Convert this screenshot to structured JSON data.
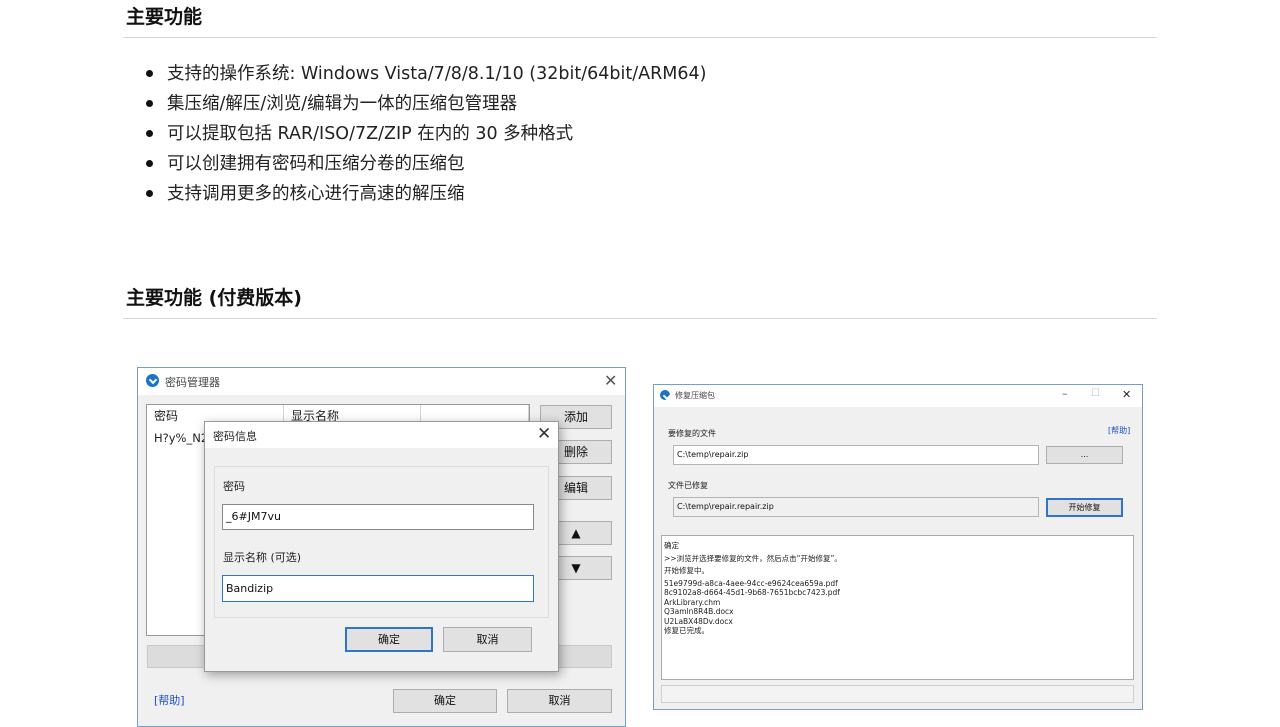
{
  "section1": {
    "heading": "主要功能",
    "features": [
      "支持的操作系统: Windows Vista/7/8/8.1/10 (32bit/64bit/ARM64)",
      "集压缩/解压/浏览/编辑为一体的压缩包管理器",
      "可以提取包括 RAR/ISO/7Z/ZIP 在内的 30 多种格式",
      "可以创建拥有密码和压缩分卷的压缩包",
      "支持调用更多的核心进行高速的解压缩"
    ]
  },
  "section2": {
    "heading": "主要功能 (付费版本)"
  },
  "password_manager": {
    "title": "密码管理器",
    "columns": [
      "密码",
      "显示名称"
    ],
    "rows": [
      {
        "password": "H?y%_N2"
      }
    ],
    "buttons": {
      "add": "添加",
      "delete": "删除",
      "edit": "编辑",
      "up": "▲",
      "down": "▼",
      "ok": "确定",
      "cancel": "取消"
    },
    "help_link": "[帮助]"
  },
  "password_info": {
    "title": "密码信息",
    "password_label": "密码",
    "password_value": "_6#JM7vu",
    "display_name_label": "显示名称 (可选)",
    "display_name_value": "Bandizip",
    "ok": "确定",
    "cancel": "取消"
  },
  "repair": {
    "title": "修复压缩包",
    "help_link": "[帮助]",
    "file_label": "要修复的文件",
    "file_value": "C:\\temp\\repair.zip",
    "browse": "...",
    "repaired_label": "文件已修复",
    "repaired_value": "C:\\temp\\repair.repair.zip",
    "start_button": "开始修复",
    "log": [
      "确定",
      ">>浏览并选择要修复的文件，然后点击“开始修复”。",
      "开始修复中。",
      "51e9799d-a8ca-4aee-94cc-e9624cea659a.pdf",
      "8c9102a8-d664-45d1-9b68-7651bcbc7423.pdf",
      "ArkLibrary.chm",
      "Q3amln8R4B.docx",
      "U2LaBX48Dv.docx",
      "修复已完成。"
    ]
  }
}
